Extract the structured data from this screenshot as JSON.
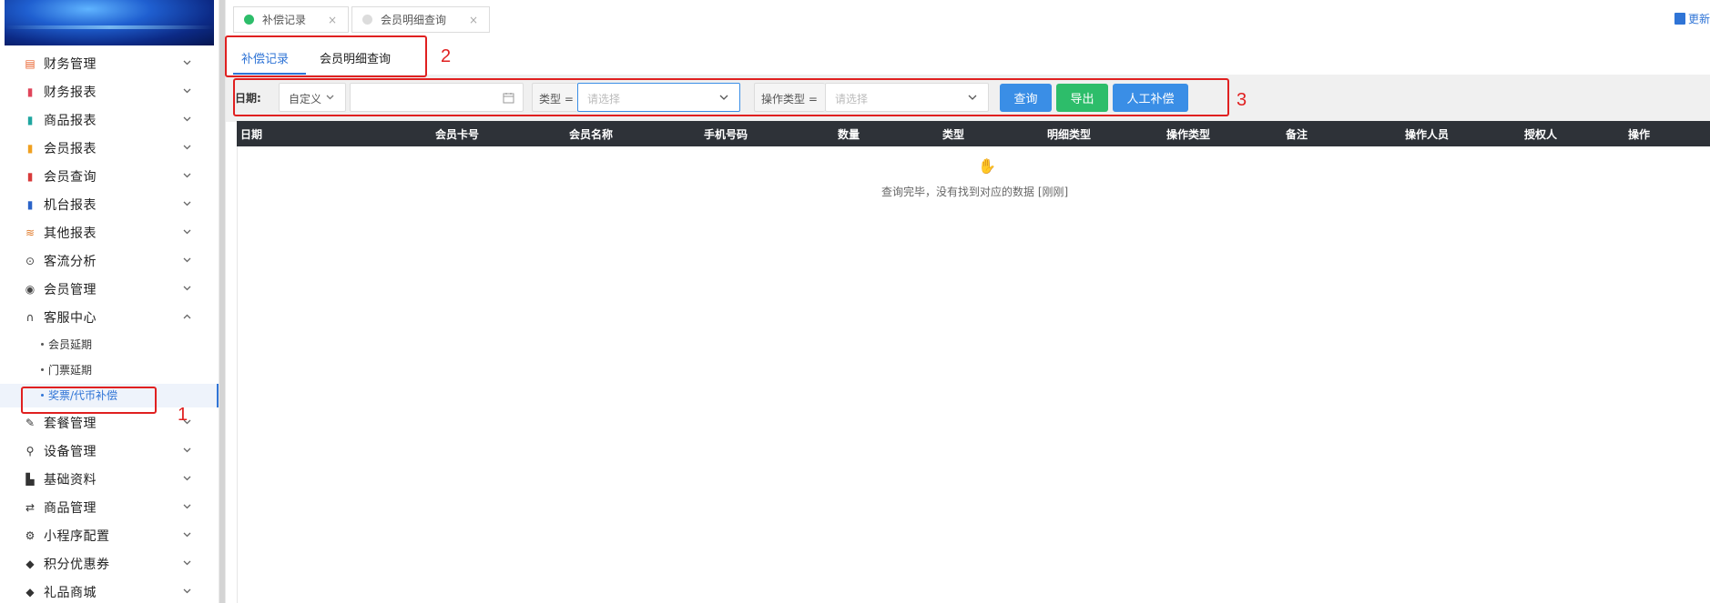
{
  "sidebar": {
    "menu": [
      {
        "label": "财务管理",
        "icon": "finance-icon",
        "color": "#e8612c",
        "expanded": false
      },
      {
        "label": "财务报表",
        "icon": "report-icon",
        "color": "#e0455a",
        "expanded": false
      },
      {
        "label": "商品报表",
        "icon": "goods-report-icon",
        "color": "#1fa6a0",
        "expanded": false
      },
      {
        "label": "会员报表",
        "icon": "member-report-icon",
        "color": "#f0a020",
        "expanded": false
      },
      {
        "label": "会员查询",
        "icon": "member-query-icon",
        "color": "#d83a3a",
        "expanded": false
      },
      {
        "label": "机台报表",
        "icon": "machine-report-icon",
        "color": "#2a63c8",
        "expanded": false
      },
      {
        "label": "其他报表",
        "icon": "layers-icon",
        "color": "#e07a2a",
        "expanded": false
      },
      {
        "label": "客流分析",
        "icon": "traffic-icon",
        "color": "#444444",
        "expanded": false
      },
      {
        "label": "会员管理",
        "icon": "user-icon",
        "color": "#444444",
        "expanded": false
      },
      {
        "label": "客服中心",
        "icon": "headset-icon",
        "color": "#333333",
        "expanded": true
      }
    ],
    "submenu": [
      {
        "label": "会员延期",
        "active": false
      },
      {
        "label": "门票延期",
        "active": false
      },
      {
        "label": "奖票/代币补偿",
        "active": true
      }
    ],
    "menu_after": [
      {
        "label": "套餐管理",
        "icon": "edit-icon"
      },
      {
        "label": "设备管理",
        "icon": "tool-icon"
      },
      {
        "label": "基础资料",
        "icon": "file-icon"
      },
      {
        "label": "商品管理",
        "icon": "swap-icon"
      },
      {
        "label": "小程序配置",
        "icon": "gear-icon"
      },
      {
        "label": "积分优惠券",
        "icon": "tag-icon"
      },
      {
        "label": "礼品商城",
        "icon": "tag-icon"
      }
    ]
  },
  "page_tabs": [
    {
      "label": "补偿记录",
      "status_color": "#2dbd6a",
      "close": "×"
    },
    {
      "label": "会员明细查询",
      "status_color": "#dcdcdc",
      "close": "×"
    }
  ],
  "update_link": "更新",
  "sub_tabs": [
    {
      "label": "补偿记录",
      "active": true
    },
    {
      "label": "会员明细查询",
      "active": false
    }
  ],
  "filters": {
    "date_label": "日期:",
    "date_mode": "自定义",
    "date_value": "",
    "type_label": "类型 =",
    "type_placeholder": "请选择",
    "op_type_label": "操作类型 =",
    "op_type_placeholder": "请选择"
  },
  "buttons": {
    "query": "查询",
    "export": "导出",
    "manual": "人工补偿",
    "query_color": "#3a8ee6",
    "export_color": "#2dbd6a",
    "manual_color": "#3a8ee6"
  },
  "table": {
    "columns": [
      "日期",
      "会员卡号",
      "会员名称",
      "手机号码",
      "数量",
      "类型",
      "明细类型",
      "操作类型",
      "备注",
      "操作人员",
      "授权人",
      "操作"
    ],
    "rows": [],
    "empty_message": "查询完毕，没有找到对应的数据 [刚刚]"
  },
  "annotations": [
    "1",
    "2",
    "3"
  ]
}
